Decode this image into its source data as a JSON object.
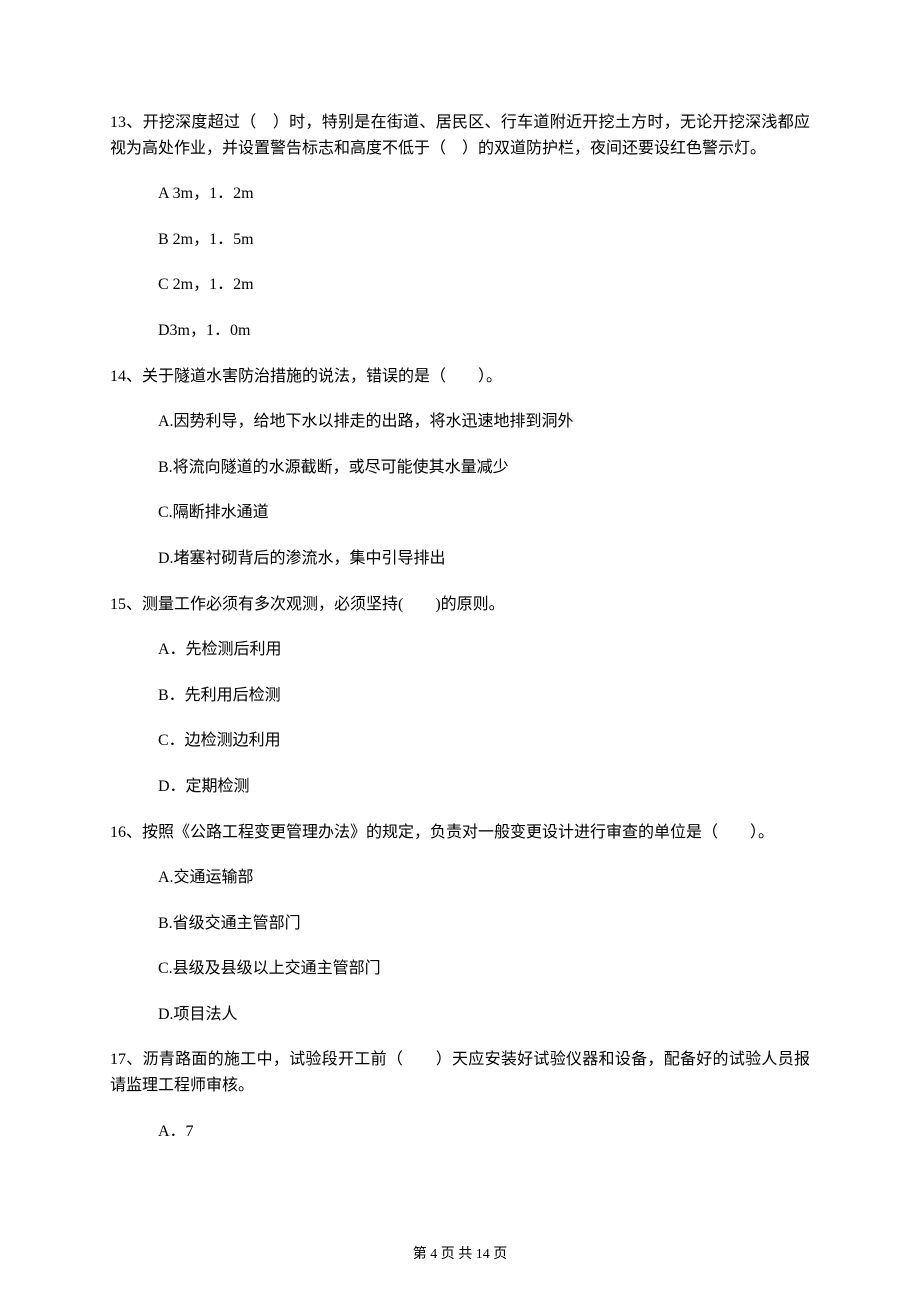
{
  "questions": [
    {
      "stem": "13、开挖深度超过（　）时，特别是在街道、居民区、行车道附近开挖土方时，无论开挖深浅都应视为高处作业，并设置警告标志和高度不低于（　）的双道防护栏，夜间还要设红色警示灯。",
      "options": [
        "A 3m，1．2m",
        "B 2m，1．5m",
        "C 2m，1．2m",
        "D3m，1．0m"
      ]
    },
    {
      "stem": "14、关于隧道水害防治措施的说法，错误的是（　　）。",
      "options": [
        "A.因势利导，给地下水以排走的出路，将水迅速地排到洞外",
        "B.将流向隧道的水源截断，或尽可能使其水量减少",
        "C.隔断排水通道",
        "D.堵塞衬砌背后的渗流水，集中引导排出"
      ]
    },
    {
      "stem": "15、测量工作必须有多次观测，必须坚持(　　)的原则。",
      "options": [
        "A．先检测后利用",
        "B．先利用后检测",
        "C．边检测边利用",
        "D．定期检测"
      ]
    },
    {
      "stem": "16、按照《公路工程变更管理办法》的规定，负责对一般变更设计进行审查的单位是（　　）。",
      "options": [
        "A.交通运输部",
        "B.省级交通主管部门",
        "C.县级及县级以上交通主管部门",
        "D.项目法人"
      ]
    },
    {
      "stem": "17、沥青路面的施工中，试验段开工前（　　）天应安装好试验仪器和设备，配备好的试验人员报请监理工程师审核。",
      "options": [
        "A．7"
      ]
    }
  ],
  "footer": "第 4 页 共 14 页"
}
